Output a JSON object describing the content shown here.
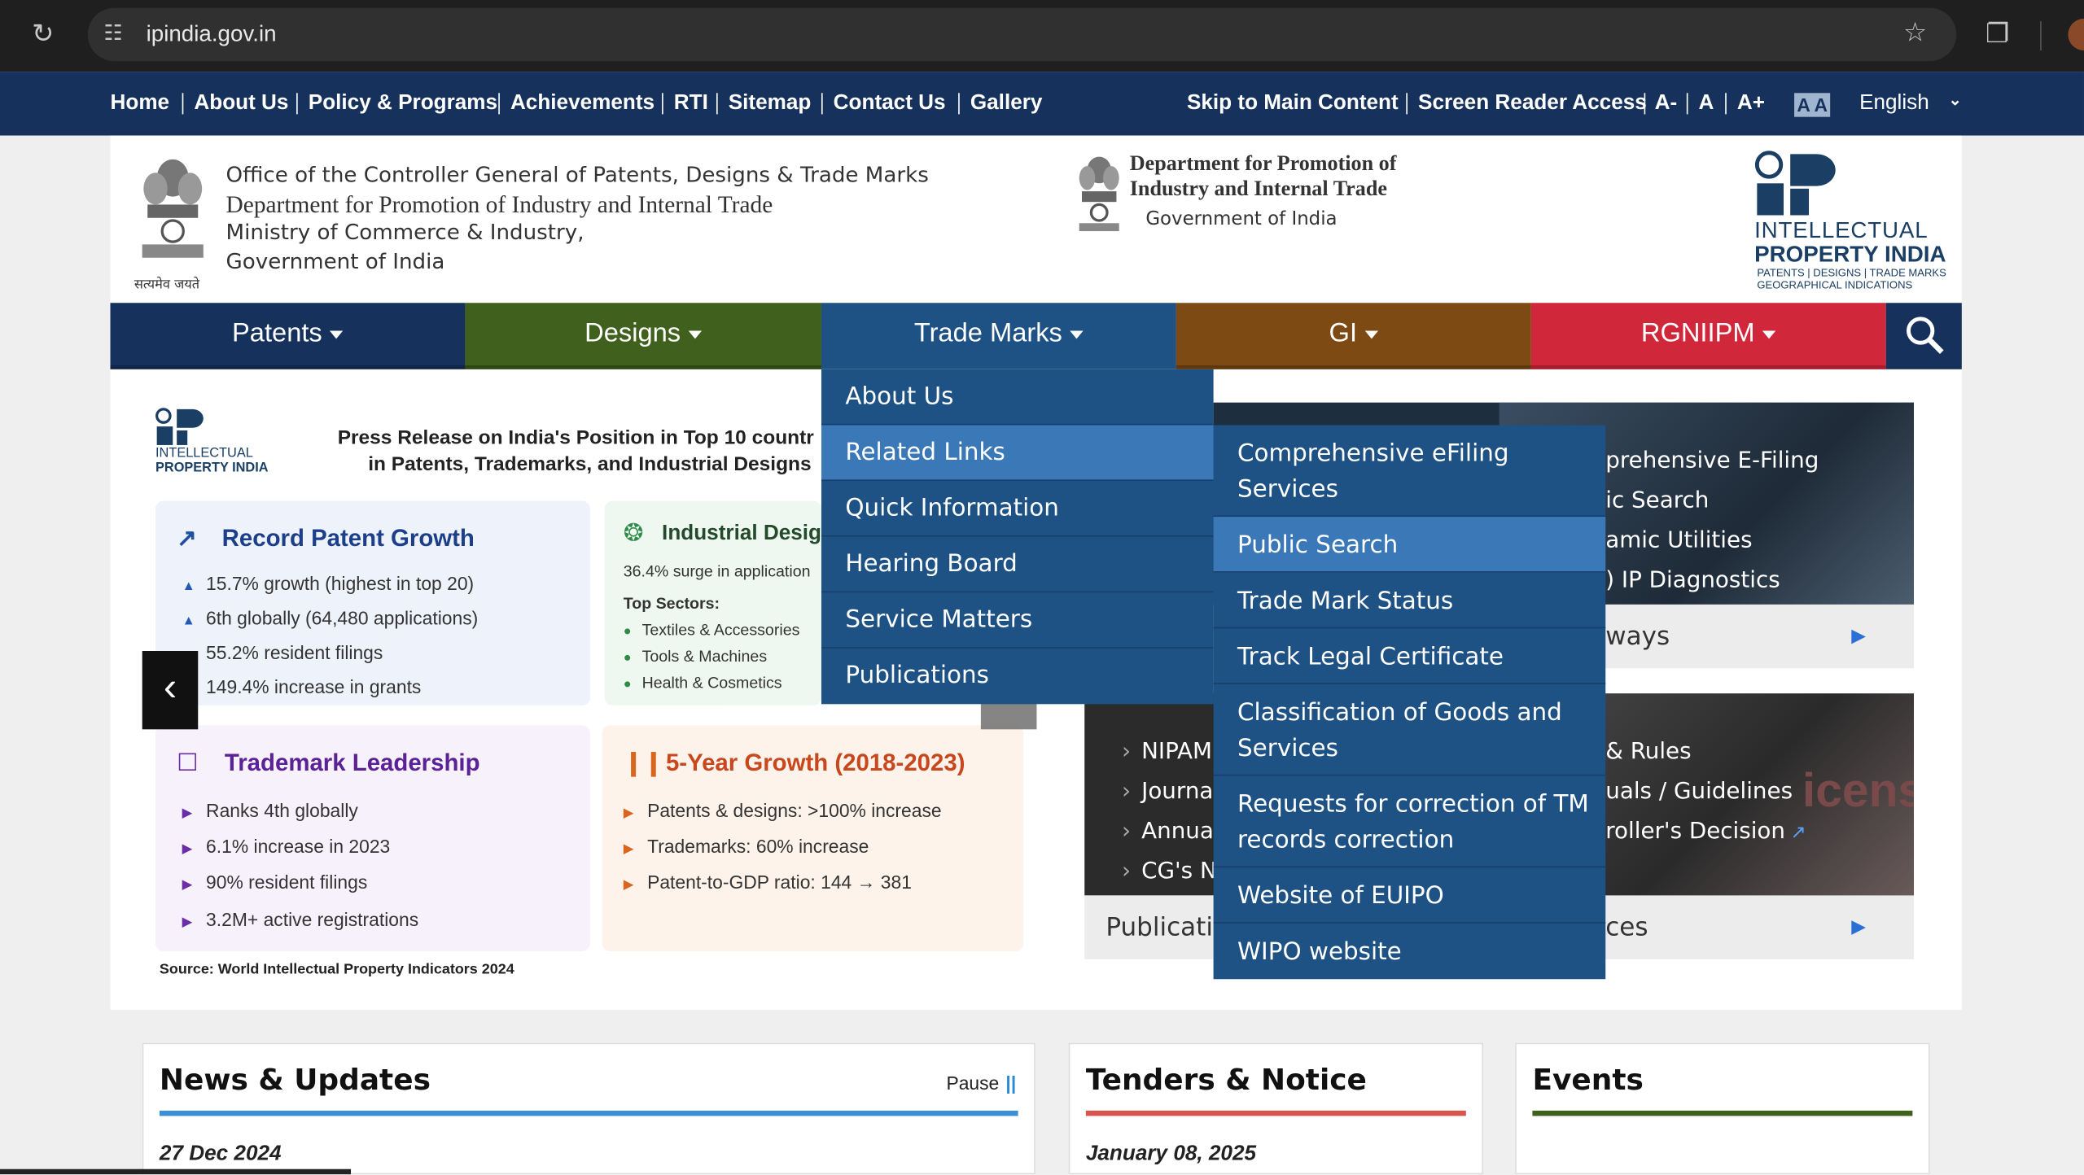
{
  "browser": {
    "url": "ipindia.gov.in"
  },
  "topbar": {
    "links": [
      "Home",
      "About Us",
      "Policy & Programs",
      "Achievements",
      "RTI",
      "Sitemap",
      "Contact Us",
      "Gallery"
    ],
    "right_links": [
      "Skip to Main Content",
      "Screen Reader Access",
      "A-",
      "A",
      "A+"
    ],
    "contrast_label": "A A",
    "language": "English"
  },
  "header": {
    "office_lines": [
      "Office of the Controller General of Patents, Designs & Trade Marks",
      "Department for Promotion of Industry and Internal Trade",
      "Ministry of Commerce & Industry,",
      "Government of India"
    ],
    "emblem_motto": "सत्यमेव जयते",
    "dept_center": [
      "Department for Promotion of",
      "Industry and Internal Trade"
    ],
    "dept_center_sub": "Government of India",
    "ipi_logo": {
      "line1": "INTELLECTUAL",
      "line2": "PROPERTY INDIA",
      "line3": "PATENTS | DESIGNS | TRADE MARKS",
      "line4": "GEOGRAPHICAL INDICATIONS"
    }
  },
  "mainnav": {
    "items": [
      "Patents",
      "Designs",
      "Trade Marks",
      "GI",
      "RGNIIPM"
    ],
    "colors": [
      "#16325c",
      "#40601d",
      "#1e5184",
      "#7e4a13",
      "#d1273a"
    ]
  },
  "banner": {
    "logo": {
      "line1": "INTELLECTUAL",
      "line2": "PROPERTY INDIA"
    },
    "press_line1": "Press Release on India's Position in Top 10 countr",
    "press_line2": "in Patents, Trademarks, and Industrial Designs",
    "cards": {
      "patent": {
        "title": "Record Patent Growth",
        "items": [
          "15.7% growth (highest in top 20)",
          "6th globally (64,480 applications)",
          "55.2% resident filings",
          "149.4% increase in grants"
        ]
      },
      "design": {
        "title": "Industrial Desig",
        "subtitle": "36.4% surge in application",
        "sectors_label": "Top Sectors:",
        "items": [
          "Textiles & Accessories",
          "Tools & Machines",
          "Health & Cosmetics"
        ]
      },
      "trademark": {
        "title": "Trademark Leadership",
        "items": [
          "Ranks 4th globally",
          "6.1% increase in 2023",
          "90% resident filings",
          "3.2M+ active registrations"
        ]
      },
      "growth": {
        "title": "5-Year Growth (2018-2023)",
        "items": [
          "Patents & designs: >100% increase",
          "Trademarks: 60% increase",
          "Patent-to-GDP ratio: 144 → 381"
        ]
      }
    },
    "source": "Source: World Intellectual Property Indicators 2024"
  },
  "trademarks_menu": {
    "items": [
      "About Us",
      "Related Links",
      "Quick Information",
      "Hearing Board",
      "Service Matters",
      "Publications"
    ],
    "active_index": 1
  },
  "related_links_menu": {
    "items": [
      "Comprehensive eFiling Services",
      "Public Search",
      "Trade Mark Status",
      "Track Legal Certificate",
      "Classification of Goods and Services",
      "Requests for correction of TM records correction",
      "Website of EUIPO",
      "WIPO website"
    ],
    "active_index": 1
  },
  "right_tiles": {
    "tile1_items": [
      "prehensive E-Filing",
      "ic Search",
      "amic Utilities",
      ") IP Diagnostics"
    ],
    "tile1_footer": "ways",
    "tile2_left_items": [
      "NIPAM",
      "Journa",
      "Annual",
      "CG's No"
    ],
    "tile2_right_items": [
      "& Rules",
      "uals / Guidelines",
      "roller's Decision"
    ],
    "tile2_watermark": "icensing",
    "tile2_footer_left": "Publicatio",
    "tile2_footer_right": "ces"
  },
  "panels": {
    "news": {
      "title": "News & Updates",
      "pause": "Pause",
      "date": "27 Dec 2024"
    },
    "tenders": {
      "title": "Tenders & Notice",
      "date": "January 08, 2025"
    },
    "events": {
      "title": "Events"
    }
  }
}
